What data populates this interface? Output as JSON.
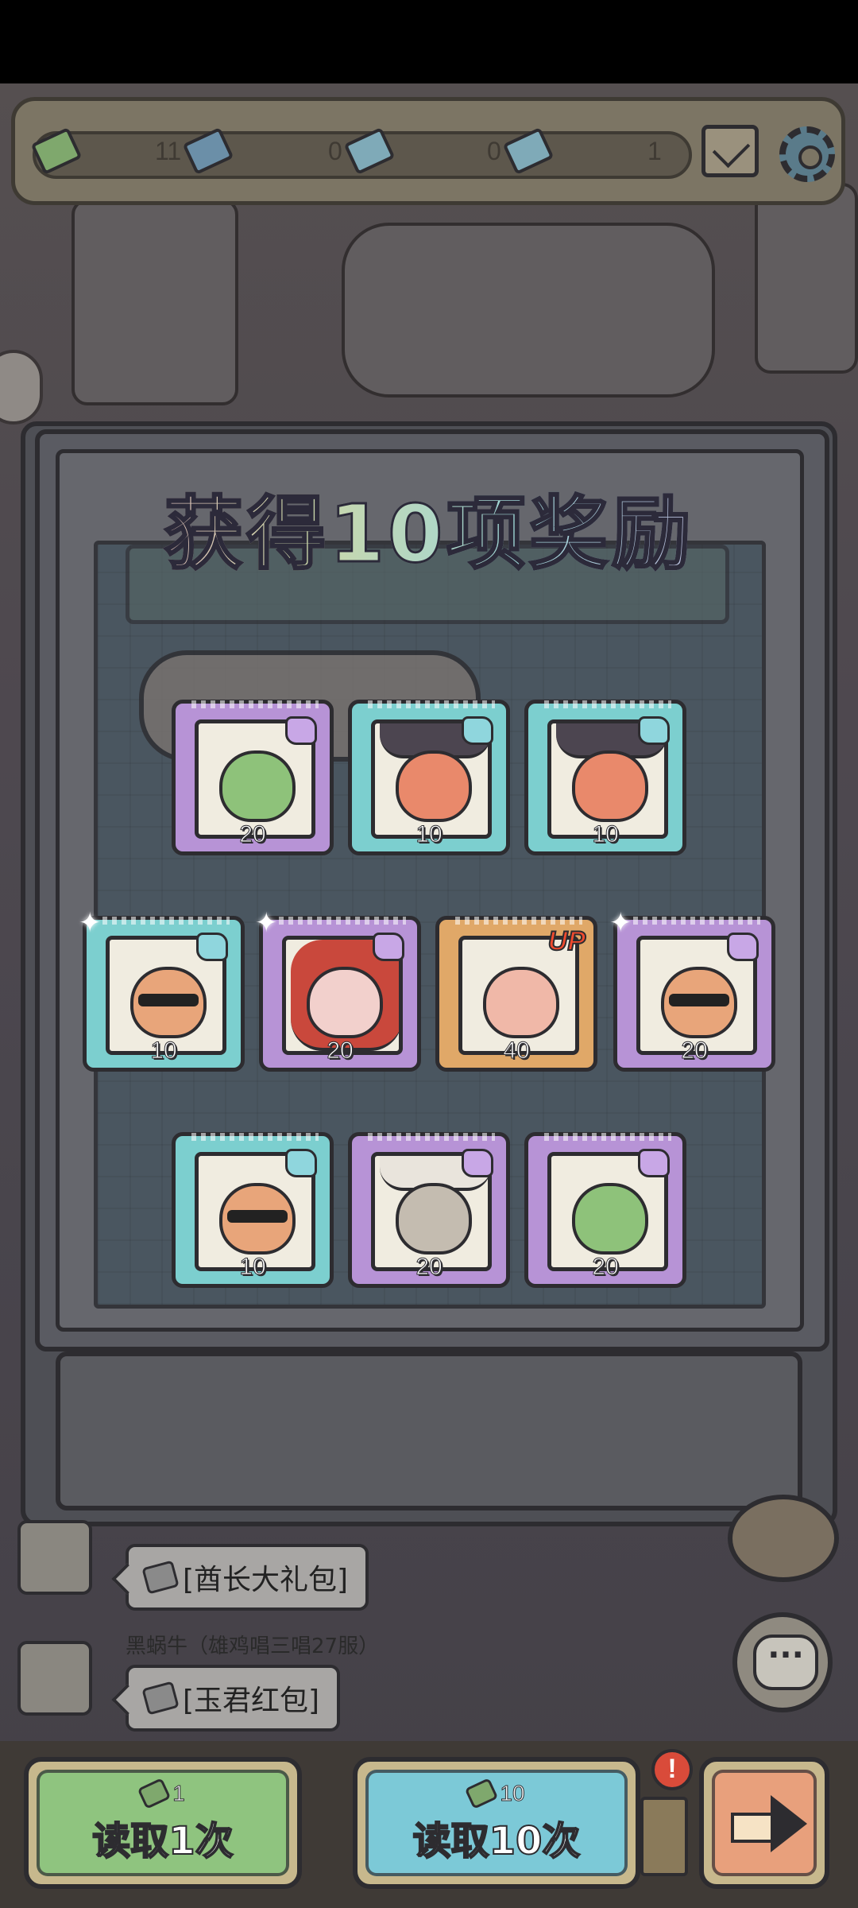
{
  "topbar": {
    "currencies": [
      {
        "name": "green-ticket",
        "count": "11",
        "color": "#7fa86d"
      },
      {
        "name": "blue-ticket",
        "count": "0",
        "color": "#6b8fa8"
      },
      {
        "name": "cyan-ticket",
        "count": "0",
        "color": "#7faab8"
      },
      {
        "name": "ticket",
        "count": "1",
        "color": "#7faab8"
      }
    ],
    "icons": [
      "mail-icon",
      "gear-icon"
    ]
  },
  "popup": {
    "title": "获得10项奖励"
  },
  "rewards": [
    {
      "rarity": "purple",
      "character": "green-mantis",
      "count": "20"
    },
    {
      "rarity": "cyan",
      "character": "samurai-fox",
      "count": "10"
    },
    {
      "rarity": "cyan",
      "character": "samurai-fox",
      "count": "10"
    },
    {
      "rarity": "cyan",
      "character": "hamster-shades",
      "count": "10",
      "sparkle": true
    },
    {
      "rarity": "purple",
      "character": "red-hair-girl",
      "count": "20",
      "sparkle": true
    },
    {
      "rarity": "orange",
      "character": "monkey-king",
      "count": "40",
      "badge": "UP"
    },
    {
      "rarity": "purple",
      "character": "hamster-shades",
      "count": "20",
      "sparkle": true
    },
    {
      "rarity": "cyan",
      "character": "hamster-shades",
      "count": "10"
    },
    {
      "rarity": "purple",
      "character": "chef-gasmask",
      "count": "20"
    },
    {
      "rarity": "purple",
      "character": "frog-monocle",
      "count": "20"
    }
  ],
  "chat": [
    {
      "name": "",
      "message": "[酋长大礼包]",
      "icon": "red-packet-icon"
    },
    {
      "name": "黑蜗牛（雄鸡唱三唱27服）",
      "message": "[玉君红包]",
      "icon": "red-packet-icon"
    }
  ],
  "bottom": {
    "read_one": {
      "cost": "1",
      "label": "读取1次"
    },
    "read_ten": {
      "cost": "10",
      "label": "读取10次"
    },
    "alert": "!"
  }
}
